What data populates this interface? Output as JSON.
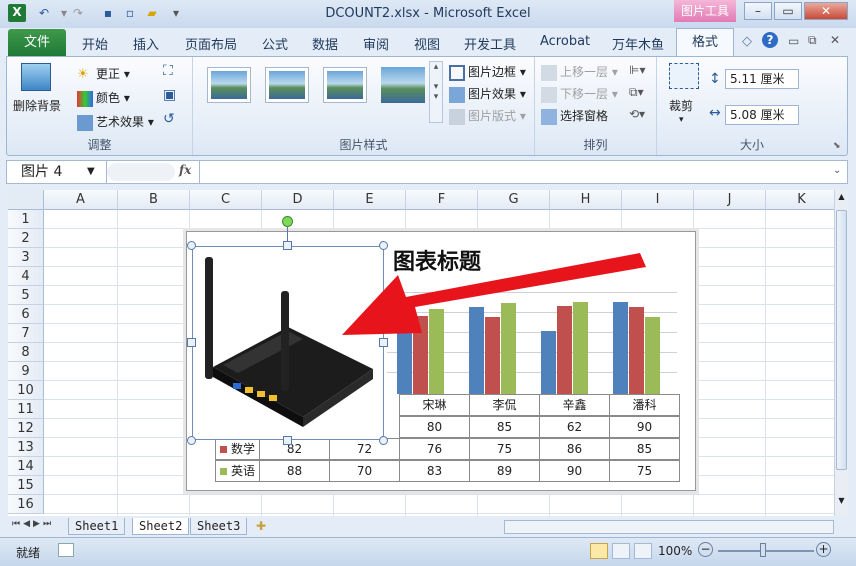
{
  "window": {
    "title": "DCOUNT2.xlsx - Microsoft Excel",
    "context_tab": "图片工具"
  },
  "tabs": [
    "文件",
    "开始",
    "插入",
    "页面布局",
    "公式",
    "数据",
    "审阅",
    "视图",
    "开发工具",
    "Acrobat",
    "万年木鱼",
    "格式"
  ],
  "ribbon": {
    "adjust": {
      "remove_bg": "删除背景",
      "corrections": "更正",
      "color": "颜色",
      "art_effects": "艺术效果",
      "label": "调整"
    },
    "styles": {
      "border": "图片边框",
      "effects": "图片效果",
      "layout": "图片版式",
      "label": "图片样式"
    },
    "arrange": {
      "bring_forward": "上移一层",
      "send_backward": "下移一层",
      "selection_pane": "选择窗格",
      "label": "排列"
    },
    "size": {
      "crop": "裁剪",
      "height": "5.11 厘米",
      "width": "5.08 厘米",
      "label": "大小"
    }
  },
  "formula_bar": {
    "name_box": "图片 4",
    "fx": "fx",
    "value": ""
  },
  "columns": [
    "A",
    "B",
    "C",
    "D",
    "E",
    "F",
    "G",
    "H",
    "I",
    "J",
    "K"
  ],
  "rows": [
    "1",
    "2",
    "3",
    "4",
    "5",
    "6",
    "7",
    "8",
    "9",
    "10",
    "11",
    "12",
    "13",
    "14",
    "15",
    "16"
  ],
  "chart": {
    "title": "图表标题",
    "people": [
      "宋琳",
      "李侃",
      "辛鑫",
      "潘科"
    ],
    "rows": [
      {
        "name": "",
        "values": [
          "80",
          "85",
          "62",
          "90"
        ]
      },
      {
        "name": "数学",
        "values": [
          "82",
          "72",
          "76",
          "75",
          "86",
          "85"
        ]
      },
      {
        "name": "英语",
        "values": [
          "88",
          "70",
          "83",
          "89",
          "90",
          "75"
        ]
      }
    ],
    "series_colors": [
      "#4f81bd",
      "#c0504d",
      "#9bbb59"
    ]
  },
  "chart_data": {
    "type": "bar",
    "title": "图表标题",
    "categories": [
      "宋琳",
      "李侃",
      "辛鑫",
      "潘科"
    ],
    "series": [
      {
        "values": [
          80,
          85,
          62,
          90
        ]
      },
      {
        "name": "数学",
        "values": [
          76,
          75,
          86,
          85
        ]
      },
      {
        "name": "英语",
        "values": [
          83,
          89,
          90,
          75
        ]
      }
    ]
  },
  "sheets": [
    "Sheet1",
    "Sheet2",
    "Sheet3"
  ],
  "active_sheet": "Sheet2",
  "status": {
    "ready": "就绪",
    "zoom": "100%"
  }
}
